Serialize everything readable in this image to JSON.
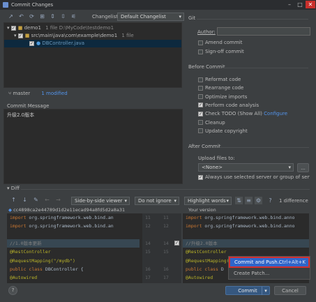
{
  "window": {
    "title": "Commit Changes"
  },
  "toolbar": {
    "changelist_label": "Changelist:",
    "changelist_value": "Default Changelist"
  },
  "tree": {
    "root": "demo1",
    "root_meta": "1 file  D:\\MyCode\\testdemo1",
    "folder": "src\\main\\java\\com\\example\\demo1",
    "folder_meta": "1 file",
    "file": "DBController.java"
  },
  "status": {
    "branch": "master",
    "modified": "1 modified"
  },
  "commit_message": {
    "label": "Commit Message",
    "text": "升级2.0版本"
  },
  "git": {
    "title": "Git",
    "author_label": "Author:",
    "amend": "Amend commit",
    "signoff": "Sign-off commit"
  },
  "before_commit": {
    "title": "Before Commit",
    "items": [
      {
        "label": "Reformat code",
        "checked": false
      },
      {
        "label": "Rearrange code",
        "checked": false
      },
      {
        "label": "Optimize imports",
        "checked": false
      },
      {
        "label": "Perform code analysis",
        "checked": true
      },
      {
        "label": "Check TODO (Show All)",
        "checked": true,
        "link": "Configure"
      },
      {
        "label": "Cleanup",
        "checked": false
      },
      {
        "label": "Update copyright",
        "checked": false
      }
    ]
  },
  "after_commit": {
    "title": "After Commit",
    "upload_label": "Upload files to:",
    "upload_value": "<None>",
    "browse": "...",
    "always": "Always use selected server or group of servers"
  },
  "diff": {
    "title": "Diff",
    "viewer": "Side-by-side viewer",
    "ignore": "Do not ignore",
    "highlight": "Highlight words",
    "count": "1 difference",
    "left_header": "cc4898ca2e44789d1d2e11ecad94a8fd5d2a8a31",
    "right_header": "Your version",
    "left_lines": [
      "import org.springframework.web.bind.an",
      "import org.springframework.web.bind.an",
      "",
      "//1.0版本更新",
      "@RestController",
      "@RequestMapping(\"/mydb\")",
      "public class DBController {",
      "    @Autowired"
    ],
    "right_lines": [
      "import org.springframework.web.bind.anno",
      "import org.springframework.web.bind.anno",
      "",
      "//升级2.0版本",
      "@RestController",
      "@RequestMapping(\"",
      "public class D",
      "    @Autowired"
    ],
    "line_numbers": [
      "11",
      "12",
      "",
      "14",
      "15",
      "",
      "16",
      "17"
    ]
  },
  "popup": {
    "primary": "Commit and Push...",
    "shortcut": "Ctrl+Alt+K",
    "secondary": "Create Patch..."
  },
  "footer": {
    "help": "?",
    "commit": "Commit",
    "cancel": "Cancel"
  }
}
